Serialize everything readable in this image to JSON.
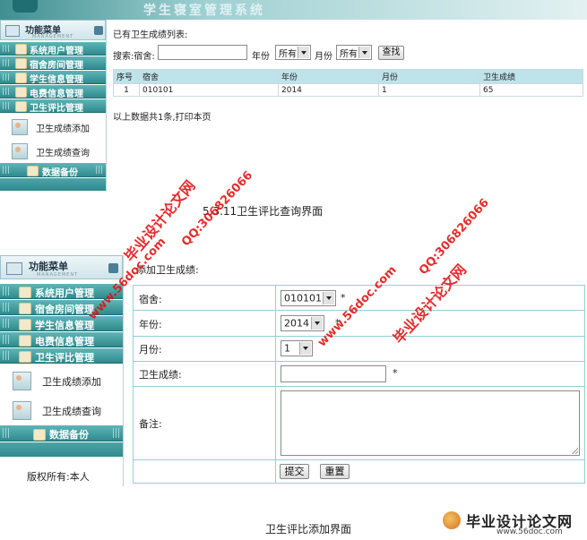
{
  "top_screen": {
    "banner_title": "学生寝室管理系统",
    "menu_title": "功能菜单",
    "menu_subtitle": "MANAGEMENT",
    "categories": [
      "系统用户管理",
      "宿舍房间管理",
      "学生信息管理",
      "电费信息管理",
      "卫生评比管理"
    ],
    "sub_items": [
      "卫生成绩添加",
      "卫生成绩查询"
    ],
    "backup": "数据备份",
    "list_title": "已有卫生成绩列表:",
    "search": {
      "label": "搜索:宿舍:",
      "year_label": "年份",
      "year_value": "所有",
      "month_label": "月份",
      "month_value": "所有",
      "button": "查找"
    },
    "table": {
      "headers": [
        "序号",
        "宿舍",
        "年份",
        "月份",
        "卫生成绩"
      ],
      "rows": [
        [
          "1",
          "010101",
          "2014",
          "1",
          "65"
        ]
      ]
    },
    "footer_text": "以上数据共1条,打印本页"
  },
  "caption_top": "5.3.11卫生评比查询界面",
  "bottom_screen": {
    "menu_title": "功能菜单",
    "menu_subtitle": "MANAGEMENT",
    "categories": [
      "系统用户管理",
      "宿舍房间管理",
      "学生信息管理",
      "电费信息管理",
      "卫生评比管理"
    ],
    "sub_items": [
      "卫生成绩添加",
      "卫生成绩查询"
    ],
    "backup": "数据备份",
    "copyright": "版权所有:本人",
    "form_title": "添加卫生成绩:",
    "fields": {
      "dorm_label": "宿舍:",
      "dorm_value": "010101",
      "year_label": "年份:",
      "year_value": "2014",
      "month_label": "月份:",
      "month_value": "1",
      "score_label": "卫生成绩:",
      "remark_label": "备注:",
      "required_mark": "*"
    },
    "buttons": {
      "submit": "提交",
      "reset": "重置"
    }
  },
  "caption_bottom": "卫生评比添加界面",
  "watermarks": {
    "site_name": "毕业设计论文网",
    "site_url": "www.56doc.com",
    "qq": "QQ:306826066",
    "logo_title": "毕业设计论文网",
    "logo_url": "www.56doc.com"
  },
  "colors": {
    "menu_teal": "#2f8a8e",
    "table_header": "#bfe3ea",
    "watermark_red": "#e11010"
  }
}
